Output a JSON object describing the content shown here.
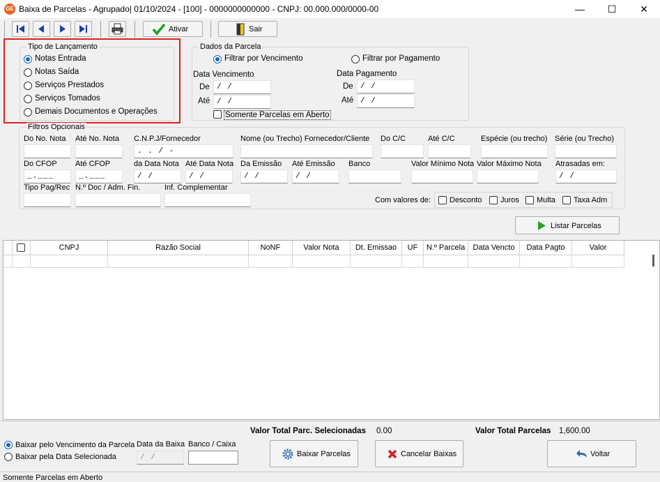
{
  "window": {
    "title": "Baixa de Parcelas - Agrupado|  01/10/2024 - [100] - 0000000000000 - CNPJ: 00.000.000/0000-00",
    "icon_text": "GE",
    "minimize": "—",
    "maximize": "☐",
    "close": "✕"
  },
  "toolbar": {
    "ativar_label": "Ativar",
    "sair_label": "Sair",
    "icons": [
      "first-icon",
      "prev-icon",
      "next-icon",
      "last-icon",
      "print-icon",
      "check-icon",
      "exit-icon"
    ]
  },
  "tipo_lancamento": {
    "title": "Tipo de Lançamento",
    "options": [
      "Notas Entrada",
      "Notas Saída",
      "Serviços Prestados",
      "Serviços Tomados",
      "Demais Documentos e Operações"
    ],
    "selected": "Notas Entrada"
  },
  "dados_parcela": {
    "title": "Dados da Parcela",
    "filtro_vencimento": "Filtrar por Vencimento",
    "filtro_pagamento": "Filtrar por Pagamento",
    "data_vencimento": "Data Vencimento",
    "data_pagamento": "Data Pagamento",
    "de": "De",
    "ate": "Até",
    "date_empty": "/ /",
    "somente_aberto": "Somente Parcelas em Aberto"
  },
  "filtros": {
    "title": "Filtros Opcionais",
    "do_no_nota": "Do No. Nota",
    "ate_no_nota": "Até No. Nota",
    "cnpj_fornecedor": "C.N.P.J/Fornecedor",
    "cnpj_mask": ". . / -",
    "nome_trecho": "Nome (ou Trecho)  Fornecedor/Cliente",
    "do_cc": "Do C/C",
    "ate_cc": "Até C/C",
    "especie": "Espécie (ou trecho)",
    "serie": "Série (ou Trecho)",
    "do_cfop": "Do CFOP",
    "ate_cfop": "Até CFOP",
    "cfop_mask": "_.___",
    "da_data_nota": "da Data Nota",
    "ate_data_nota": "Até Data Nota",
    "da_emissao": "Da Emissão",
    "ate_emissao": "Até Emissão",
    "banco": "Banco",
    "valor_minimo": "Valor Mínimo Nota",
    "valor_maximo": "Valor Máximo Nota",
    "atrasadas_em": "Atrasadas em:",
    "tipo_pag_rec": "Tipo Pag/Rec",
    "no_doc_adm": "N.º Doc / Adm. Fin.",
    "inf_complementar": "Inf. Complementar",
    "com_valores_de": "Com valores de:",
    "desconto": "Desconto",
    "juros": "Juros",
    "multa": "Multa",
    "taxa_adm": "Taxa Adm"
  },
  "listar_parcelas": "Listar Parcelas",
  "grid": {
    "columns": [
      "",
      "CNPJ",
      "Razão Social",
      "NoNF",
      "Valor Nota",
      "Dt. Emissao",
      "UF",
      "N.º Parcela",
      "Data Vencto",
      "Data Pagto",
      "Valor"
    ]
  },
  "footer": {
    "valor_total_selecionadas_label": "Valor Total Parc. Selecionadas",
    "valor_total_selecionadas": "0.00",
    "valor_total_parcelas_label": "Valor Total Parcelas",
    "valor_total_parcelas": "1,600.00",
    "baixar_vencimento": "Baixar pelo Vencimento da Parcela",
    "baixar_data_selecionada": "Baixar pela Data Selecionada",
    "data_da_baixa": "Data da Baixa",
    "banco_caixa": "Banco / Caixa",
    "date_empty": "/ /",
    "baixar_parcelas": "Baixar Parcelas",
    "cancelar_baixas": "Cancelar Baixas",
    "voltar": "Voltar"
  },
  "status": "Somente Parcelas em Aberto"
}
